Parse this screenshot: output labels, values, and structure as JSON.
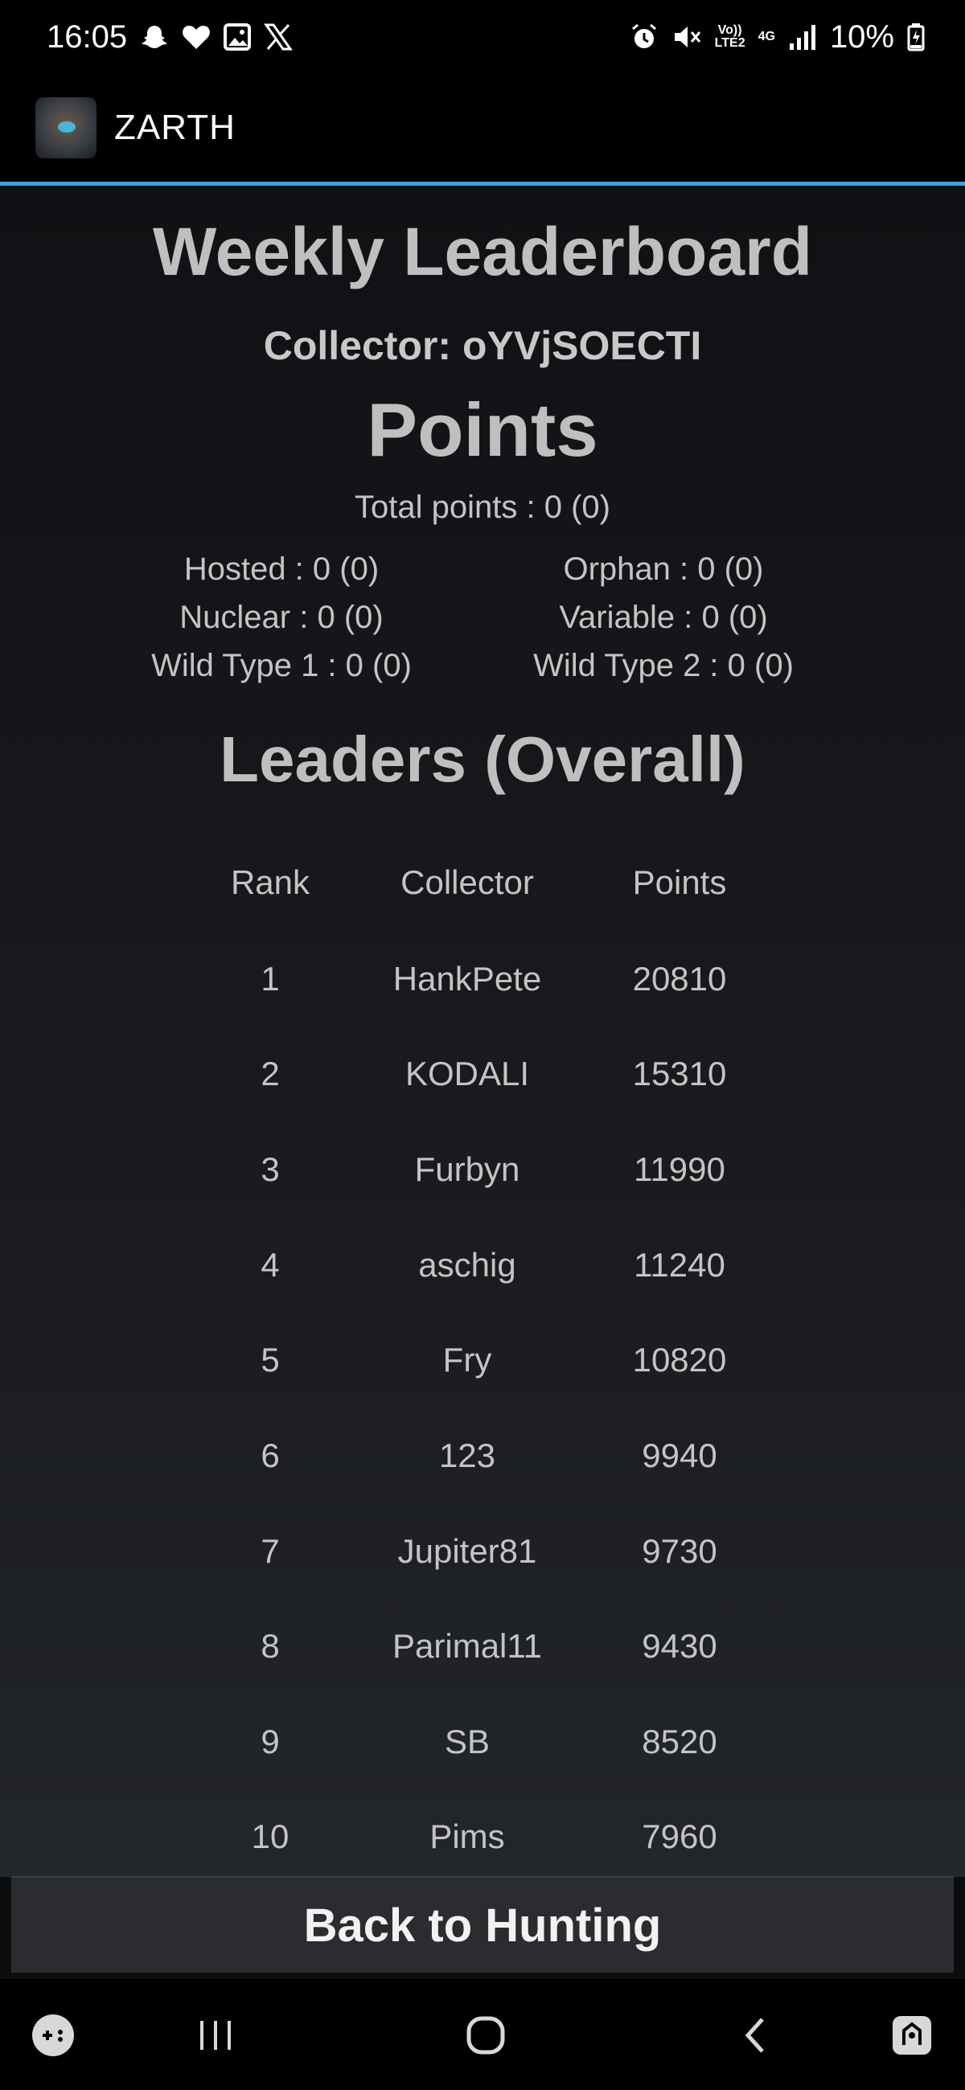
{
  "status": {
    "time": "16:05",
    "net_top": "Vo))",
    "net_bottom": "LTE2",
    "net_gen": "4G",
    "battery": "10%"
  },
  "app": {
    "title": "ZARTH"
  },
  "page": {
    "title": "Weekly Leaderboard",
    "collector": "Collector: oYVjSOECTI",
    "points_title": "Points",
    "total_points": "Total points : 0 (0)",
    "stats": [
      {
        "left": "Hosted : 0 (0)",
        "right": "Orphan : 0 (0)"
      },
      {
        "left": "Nuclear : 0 (0)",
        "right": "Variable : 0 (0)"
      },
      {
        "left": "Wild Type 1 : 0 (0)",
        "right": "Wild Type 2 : 0 (0)"
      }
    ],
    "leaders_title": "Leaders (Overall)"
  },
  "table": {
    "headers": [
      "Rank",
      "Collector",
      "Points"
    ],
    "rows": [
      [
        "1",
        "HankPete",
        "20810"
      ],
      [
        "2",
        "KODALI",
        "15310"
      ],
      [
        "3",
        "Furbyn",
        "11990"
      ],
      [
        "4",
        "aschig",
        "11240"
      ],
      [
        "5",
        "Fry",
        "10820"
      ],
      [
        "6",
        "123",
        "9940"
      ],
      [
        "7",
        "Jupiter81",
        "9730"
      ],
      [
        "8",
        "Parimal11",
        "9430"
      ],
      [
        "9",
        "SB",
        "8520"
      ],
      [
        "10",
        "Pims",
        "7960"
      ]
    ]
  },
  "footer": {
    "back_label": "Back to Hunting"
  },
  "icons": {
    "status_left": [
      "snapchat-icon",
      "heart-icon",
      "gallery-icon",
      "x-icon"
    ],
    "status_right": [
      "alarm-icon",
      "mute-icon",
      "signal-icon",
      "battery-charging-icon"
    ],
    "nav": [
      "game-launcher-icon",
      "recent-apps-icon",
      "home-icon",
      "back-icon",
      "accessibility-icon"
    ]
  },
  "colors": {
    "accent": "#3aa6d8",
    "background": "#101114",
    "text": "#c4c4c4"
  }
}
